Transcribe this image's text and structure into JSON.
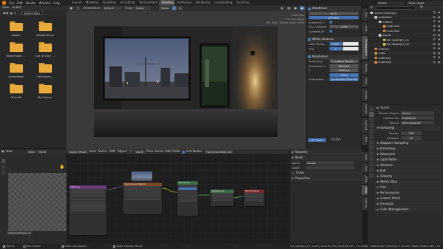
{
  "topbar": {
    "menus": [
      "File",
      "Edit",
      "Render",
      "Window",
      "Help"
    ],
    "workspaces": [
      "Layout",
      "Modeling",
      "Sculpting",
      "UV Editing",
      "Texture Paint",
      "Shading",
      "Animation",
      "Rendering",
      "Compositing",
      "Scripting"
    ],
    "active_workspace": "Shading",
    "scene_name": "Scene",
    "view_layer": "View Layer"
  },
  "file_browser": {
    "menus": [
      "View",
      "Select"
    ],
    "path": "C:\\Users\\Yaba...",
    "folders": [
      "Adobe",
      "Allegorithmic",
      "Blackmagic ...",
      "Call of Duty ...",
      "Downloads",
      "Gelcelopra...",
      "GHosoft",
      "My Games"
    ]
  },
  "viewport": {
    "header": {
      "orientation_label": "Orientation:",
      "orientation_value": "Default",
      "drag_label": "Drag:",
      "drag_value": "Tweak",
      "transform_space": "Global"
    },
    "overlay_text": [
      "False Color",
      "EV: Look: None",
      "FPS: 16.6 · Shutter Angle: 180.0"
    ]
  },
  "n_panel": {
    "autofocus": {
      "title": "Autofocus",
      "af_s": "AF-S",
      "af_track": "AF-Track",
      "enable_label": "Enable AF-C",
      "interval_label": "AF-C Interval",
      "interval_value": "1.00",
      "animate_label": "Animate AF"
    },
    "white_balance": {
      "title": "White Balance",
      "temp_label": "Color Temp...",
      "temp_value": "5500",
      "tint_label": "Tint",
      "tint_value": "0"
    },
    "resolution": {
      "title": "Resolution",
      "rows": [
        [
          "Resolution",
          "1 custom Resolu..."
        ],
        [
          "Resolution X",
          "1920 px"
        ],
        [
          "Y",
          "1080 px"
        ],
        [
          "",
          "100%"
        ],
        [
          "Orientation",
          "Landscape / Portrait"
        ]
      ]
    },
    "tabs": [
      "Tool",
      "View",
      "Photographer",
      "Render",
      "Node",
      "Image",
      "Options",
      "LuxCore",
      "Fast"
    ],
    "focus_plane_label": "10.0m",
    "af_track_button": "AF Track"
  },
  "outliner": {
    "rows": [
      {
        "label": "Scene Collection",
        "indent": 0,
        "icon_color": "#cfcfcf"
      },
      {
        "label": "Collection",
        "indent": 1,
        "icon_color": "#cfcfcf"
      },
      {
        "label": "Cutters",
        "indent": 2,
        "icon_color": "#cfcfcf"
      },
      {
        "label": "Cube.001",
        "indent": 3,
        "icon_color": "#e0883a"
      },
      {
        "label": "Cube.002",
        "indent": 3,
        "icon_color": "#e0883a"
      },
      {
        "label": "Assets",
        "indent": 2,
        "icon_color": "#cfcfcf"
      },
      {
        "label": "Ext_Spotlight_01",
        "indent": 3,
        "icon_color": "#c9c950"
      },
      {
        "label": "Ext_Spotlight_02",
        "indent": 3,
        "icon_color": "#c9c950"
      },
      {
        "label": "Camera",
        "indent": 1,
        "icon_color": "#e0883a"
      },
      {
        "label": "Cube",
        "indent": 1,
        "icon_color": "#e0883a"
      },
      {
        "label": "Cube.001",
        "indent": 1,
        "icon_color": "#e0883a"
      },
      {
        "label": "Cube.003",
        "indent": 1,
        "icon_color": "#e0883a"
      }
    ]
  },
  "properties": {
    "scene_label": "Scene",
    "rows": [
      {
        "label": "Render Engine",
        "value": "Cycles"
      },
      {
        "label": "Feature Set",
        "value": "Supported"
      },
      {
        "label": "Device",
        "value": "GPU Compute"
      }
    ],
    "sampling_title": "Sampling",
    "sampling": [
      {
        "label": "Render",
        "value": "128"
      },
      {
        "label": "Viewport",
        "value": "32"
      }
    ],
    "sections": [
      "Adaptive Sampling",
      "Denoising",
      "Advanced",
      "Light Paths",
      "Volumes",
      "Hair",
      "Simplify",
      "Motion Blur",
      "Film",
      "Performance",
      "Grease Pencil",
      "Freestyle",
      "Color Management"
    ]
  },
  "image_editor": {
    "menus": [
      "View",
      "New",
      "Open"
    ],
    "image_name": "HachimanRoad.exr"
  },
  "node_editor": {
    "header": {
      "object_mode": "Object Mode",
      "menus": [
        "View",
        "Select",
        "Add",
        "Object"
      ],
      "type": "World",
      "use_nodes_label": "Use Nodes",
      "image_name": "HachimanRoad.exr",
      "node_menus": [
        "View",
        "Select",
        "Add",
        "Node"
      ]
    },
    "nodes": [
      {
        "title": "Mapping",
        "color": "#6a3a7a"
      },
      {
        "title": "Environment Texture",
        "color": "#7a4a2a"
      },
      {
        "title": "Mix Shader",
        "color": "#3b6b4b"
      },
      {
        "title": "Background",
        "color": "#3b6b4b"
      },
      {
        "title": "World Output",
        "color": "#7a2a2a"
      }
    ]
  },
  "node_side": {
    "recent_title": "Recently",
    "node_title": "Node",
    "name_label": "Name",
    "name_value": "Group",
    "label_label": "Label",
    "label_value": "",
    "color_label": "Color",
    "properties_title": "Properties",
    "tabs": [
      "Item",
      "Tool",
      "View",
      "Node",
      "Options"
    ]
  },
  "status": {
    "left": "Select",
    "box": "Box Select",
    "move": "Move and Attach",
    "context": "Node Context Menu",
    "info": "Ext_Spotlight_01 | Cube | Verts:39,598 | Faces:38,762 | Tris:79,624 | Objects:0/14 | Memory: 1.38 GiB | VRAM: 0.8/8.0 GiB | 2.92"
  }
}
